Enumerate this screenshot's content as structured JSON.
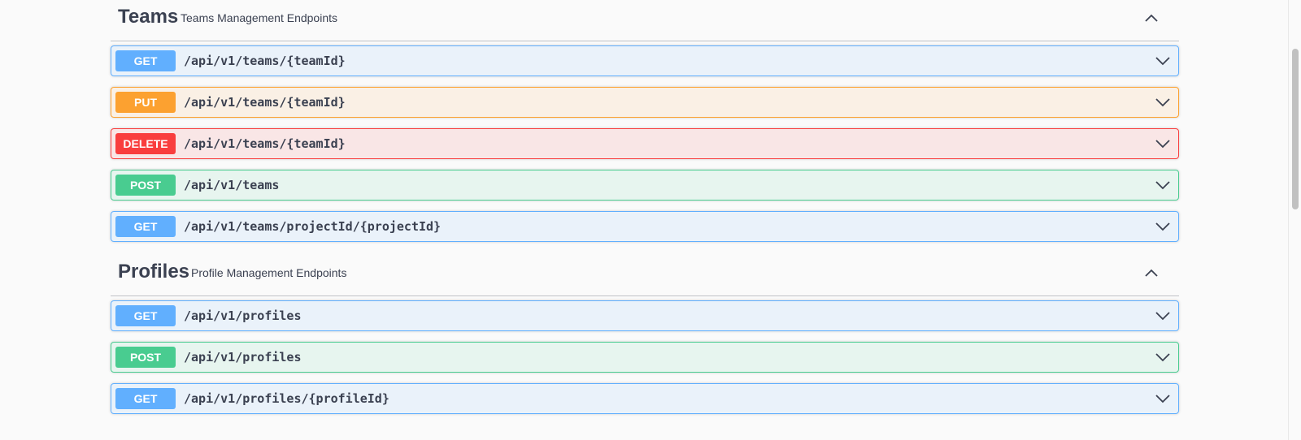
{
  "sections": [
    {
      "name": "Teams",
      "description": "Teams Management Endpoints",
      "operations": [
        {
          "method": "GET",
          "path": "/api/v1/teams/{teamId}"
        },
        {
          "method": "PUT",
          "path": "/api/v1/teams/{teamId}"
        },
        {
          "method": "DELETE",
          "path": "/api/v1/teams/{teamId}"
        },
        {
          "method": "POST",
          "path": "/api/v1/teams"
        },
        {
          "method": "GET",
          "path": "/api/v1/teams/projectId/{projectId}"
        }
      ]
    },
    {
      "name": "Profiles",
      "description": "Profile Management Endpoints",
      "operations": [
        {
          "method": "GET",
          "path": "/api/v1/profiles"
        },
        {
          "method": "POST",
          "path": "/api/v1/profiles"
        },
        {
          "method": "GET",
          "path": "/api/v1/profiles/{profileId}"
        }
      ]
    }
  ],
  "icons": {
    "collapse": "chevron-up-icon",
    "expand": "chevron-down-icon"
  },
  "colors": {
    "get": "#61affe",
    "put": "#fca130",
    "delete": "#f93e3e",
    "post": "#49cc90",
    "text": "#3b4151"
  }
}
